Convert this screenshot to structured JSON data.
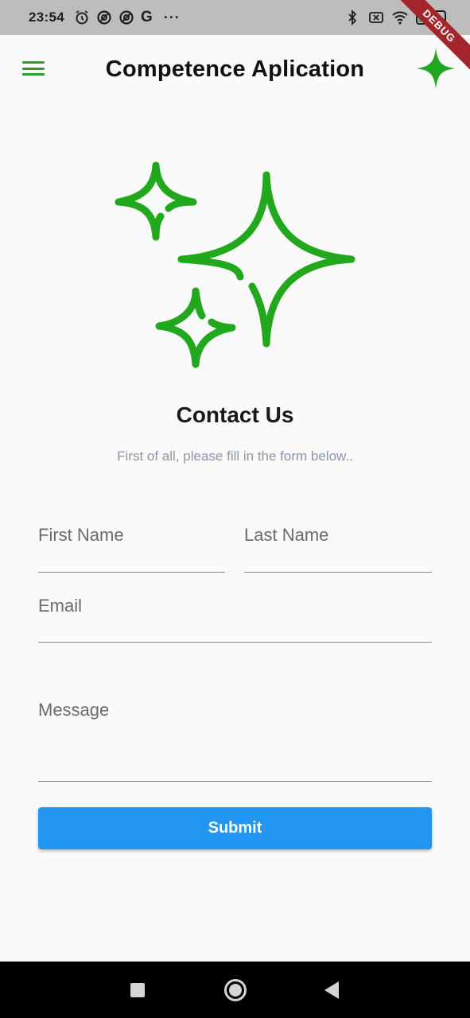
{
  "status_bar": {
    "time": "23:54",
    "google_glyph": "G",
    "more": "···",
    "battery_level": "33"
  },
  "debug_banner": "DEBUG",
  "app_bar": {
    "title": "Competence Aplication"
  },
  "contact": {
    "title": "Contact Us",
    "subtitle": "First of all, please fill in the form below.."
  },
  "form": {
    "first_name_placeholder": "First Name",
    "last_name_placeholder": "Last Name",
    "email_placeholder": "Email",
    "message_placeholder": "Message",
    "submit_label": "Submit"
  },
  "colors": {
    "accent_green": "#22a81c",
    "button_blue": "#2196f3"
  },
  "icons": [
    "menu-icon",
    "sparkle-icon",
    "alarm-icon",
    "at-icon",
    "bluetooth-icon",
    "wifi-icon",
    "battery-icon"
  ]
}
